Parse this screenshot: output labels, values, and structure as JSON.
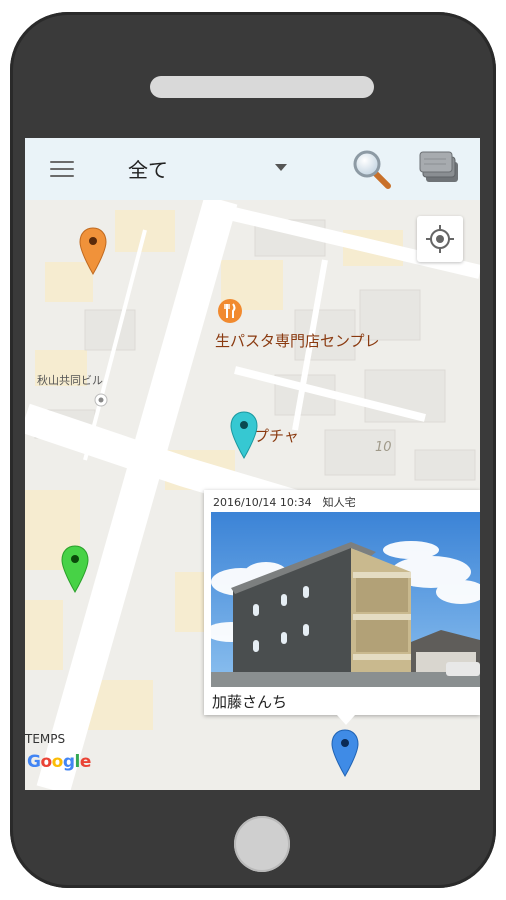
{
  "appbar": {
    "filter_label": "全て",
    "menu_icon": "hamburger-menu-icon",
    "search_icon": "magnifier-search-icon",
    "layers_icon": "stacked-layers-icon"
  },
  "map": {
    "poi_restaurant_1": "生パスタ専門店センプレ",
    "poi_restaurant_2": "ラプチャ",
    "building_label": "秋山共同ビル",
    "address_number": "10",
    "attribution_temps": "TEMPS",
    "attribution_google": "Google",
    "locate_icon": "crosshair-locate-icon"
  },
  "markers": [
    {
      "color": "#f0923a"
    },
    {
      "color": "#36c8d2"
    },
    {
      "color": "#47d246"
    },
    {
      "color": "#3f8be6"
    }
  ],
  "info_window": {
    "meta": "2016/10/14 10:34　知人宅",
    "title": "加藤さんち"
  },
  "colors": {
    "phone_body": "#3a3a3a",
    "appbar_bg": "#eaf3f8",
    "map_bg": "#efeeea",
    "road": "#ffffff",
    "poi_orange": "#f18a2f"
  }
}
